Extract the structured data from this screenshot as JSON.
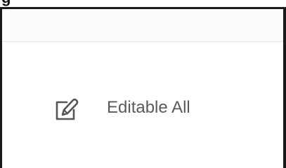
{
  "menu": {
    "items": [
      {
        "label": "Editable All",
        "icon": "edit-icon"
      }
    ]
  },
  "colors": {
    "border": "#1a1a1a",
    "header_background": "#fbfbfb",
    "label_text": "#5a5a5a",
    "icon_stroke": "#555555"
  }
}
